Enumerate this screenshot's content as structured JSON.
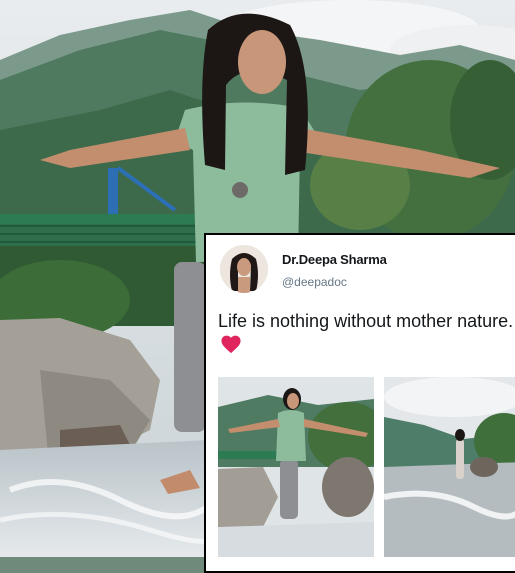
{
  "tweet": {
    "display_name": "Dr.Deepa Sharma",
    "handle": "@deepadoc",
    "text": "Life is nothing without mother nature.",
    "heart_icon": "red-heart-emoji"
  },
  "colors": {
    "heart": "#e0245e",
    "name": "#14171a",
    "handle": "#657786",
    "card_border": "#000000"
  }
}
